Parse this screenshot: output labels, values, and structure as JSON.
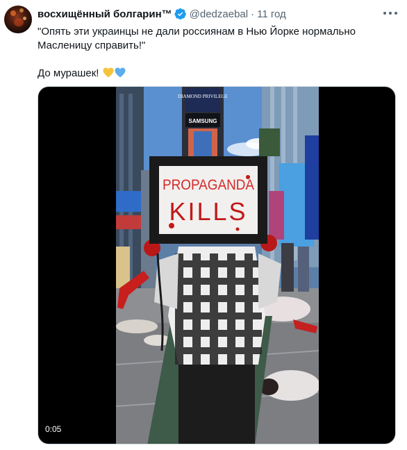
{
  "tweet": {
    "display_name": "восхищённый болгарин™",
    "handle": "@dedzaebal",
    "separator": "·",
    "time": "11 год",
    "text_line1": "\"Опять эти украинцы не дали россиянам в Нью Йорке нормально",
    "text_line2": "Масленицу справить!\"",
    "text_line3": "До мурашек!",
    "emojis": [
      "yellow-heart",
      "blue-heart"
    ]
  },
  "media": {
    "timestamp": "0:05",
    "sign_line1": "PROPAGANDA",
    "sign_line2": "KILLS",
    "billboard_top": "DIAMOND PRIVILEGE",
    "billboard_samsung": "SAMSUNG"
  },
  "colors": {
    "verified": "#1d9bf0",
    "secondary_text": "#536471",
    "yellow_heart": "#f5c33b",
    "blue_heart": "#5dadec"
  }
}
